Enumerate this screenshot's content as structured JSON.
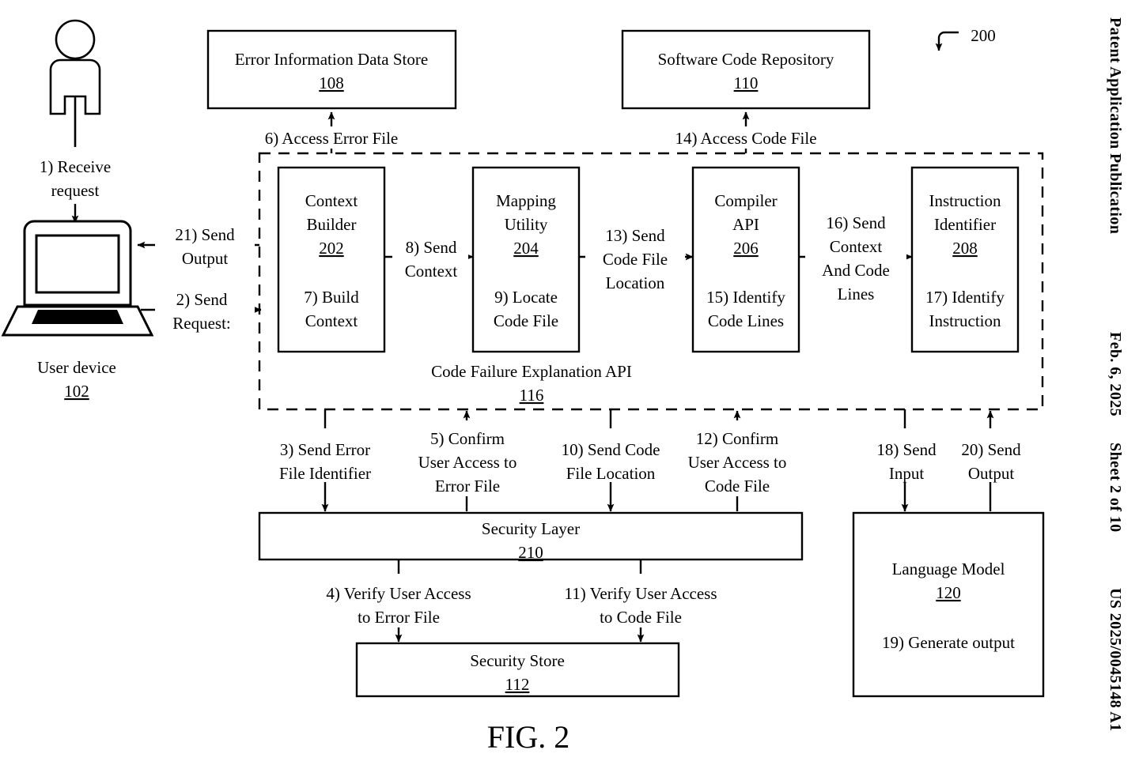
{
  "page": {
    "figure_caption": "FIG. 2",
    "diagram_ref": "200",
    "sidebar": {
      "publication": "Patent Application Publication",
      "date": "Feb. 6, 2025",
      "sheet": "Sheet 2 of 10",
      "pub_number": "US 2025/0045148 A1"
    }
  },
  "nodes": {
    "user_device": {
      "label": "User device",
      "ref": "102"
    },
    "error_store": {
      "label": "Error Information Data Store",
      "ref": "108"
    },
    "code_repo": {
      "label": "Software Code Repository",
      "ref": "110"
    },
    "context_builder": {
      "label_line1": "Context",
      "label_line2": "Builder",
      "ref": "202",
      "step_line1": "7) Build",
      "step_line2": "Context"
    },
    "mapping_utility": {
      "label_line1": "Mapping",
      "label_line2": "Utility",
      "ref": "204",
      "step_line1": "9) Locate",
      "step_line2": "Code File"
    },
    "compiler_api": {
      "label_line1": "Compiler",
      "label_line2": "API",
      "ref": "206",
      "step_line1": "15) Identify",
      "step_line2": "Code Lines"
    },
    "instruction_identifier": {
      "label_line1": "Instruction",
      "label_line2": "Identifier",
      "ref": "208",
      "step_line1": "17) Identify",
      "step_line2": "Instruction"
    },
    "explanation_api": {
      "label": "Code Failure Explanation API",
      "ref": "116"
    },
    "security_layer": {
      "label": "Security Layer",
      "ref": "210"
    },
    "security_store": {
      "label": "Security Store",
      "ref": "112"
    },
    "language_model": {
      "label": "Language Model",
      "ref": "120",
      "step": "19) Generate output"
    }
  },
  "steps": {
    "s1": {
      "line1": "1) Receive",
      "line2": "request"
    },
    "s2": {
      "line1": "2) Send",
      "line2": "Request:"
    },
    "s3": {
      "line1": "3) Send Error",
      "line2": "File Identifier"
    },
    "s4": {
      "line1": "4) Verify User Access",
      "line2": "to Error File"
    },
    "s5": {
      "line1": "5) Confirm",
      "line2": "User Access to",
      "line3": "Error File"
    },
    "s6": {
      "line1": "6) Access Error File"
    },
    "s8": {
      "line1": "8) Send",
      "line2": "Context"
    },
    "s10": {
      "line1": "10) Send Code",
      "line2": "File Location"
    },
    "s11": {
      "line1": "11) Verify User Access",
      "line2": "to Code File"
    },
    "s12": {
      "line1": "12) Confirm",
      "line2": "User Access to",
      "line3": "Code File"
    },
    "s13": {
      "line1": "13) Send",
      "line2": "Code File",
      "line3": "Location"
    },
    "s14": {
      "line1": "14) Access Code File"
    },
    "s16": {
      "line1": "16) Send",
      "line2": "Context",
      "line3": "And Code",
      "line4": "Lines"
    },
    "s18": {
      "line1": "18) Send",
      "line2": "Input"
    },
    "s20": {
      "line1": "20) Send",
      "line2": "Output"
    },
    "s21": {
      "line1": "21) Send",
      "line2": "Output"
    }
  },
  "colors": {
    "ink": "#000000",
    "paper": "#ffffff"
  }
}
